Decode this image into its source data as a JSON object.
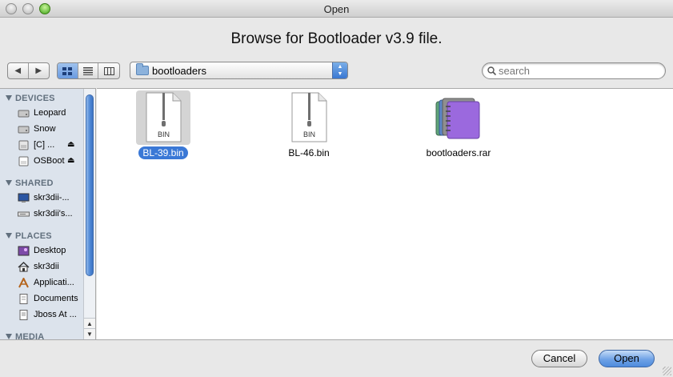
{
  "window": {
    "title": "Open"
  },
  "prompt": "Browse for Bootloader v3.9 file.",
  "toolbar": {
    "back_icon": "back-arrow-icon",
    "forward_icon": "forward-arrow-icon",
    "view_modes": [
      "icon-view",
      "list-view",
      "column-view"
    ],
    "active_view": "icon-view",
    "location": "bootloaders",
    "search_placeholder": "search"
  },
  "sidebar": {
    "devices_header": "DEVICES",
    "devices": [
      {
        "label": "Leopard",
        "icon": "hard-drive-icon"
      },
      {
        "label": "Snow",
        "icon": "hard-drive-icon"
      },
      {
        "label": "[C] ...",
        "icon": "disk-icon",
        "eject": "⏏"
      },
      {
        "label": "OSBoot",
        "icon": "disk-icon",
        "eject": "⏏"
      }
    ],
    "shared_header": "SHARED",
    "shared": [
      {
        "label": "skr3dii-...",
        "icon": "monitor-icon"
      },
      {
        "label": "skr3dii's...",
        "icon": "network-computer-icon"
      }
    ],
    "places_header": "PLACES",
    "places": [
      {
        "label": "Desktop",
        "icon": "desktop-icon"
      },
      {
        "label": "skr3dii",
        "icon": "home-icon"
      },
      {
        "label": "Applicati...",
        "icon": "applications-icon"
      },
      {
        "label": "Documents",
        "icon": "documents-icon"
      },
      {
        "label": "Jboss At ...",
        "icon": "document-icon"
      }
    ],
    "media_header": "MEDIA"
  },
  "files": [
    {
      "name": "BL-39.bin",
      "type": "bin",
      "label": "BIN",
      "selected": true
    },
    {
      "name": "BL-46.bin",
      "type": "bin",
      "label": "BIN",
      "selected": false
    },
    {
      "name": "bootloaders.rar",
      "type": "rar",
      "selected": false
    }
  ],
  "footer": {
    "cancel": "Cancel",
    "open": "Open"
  }
}
